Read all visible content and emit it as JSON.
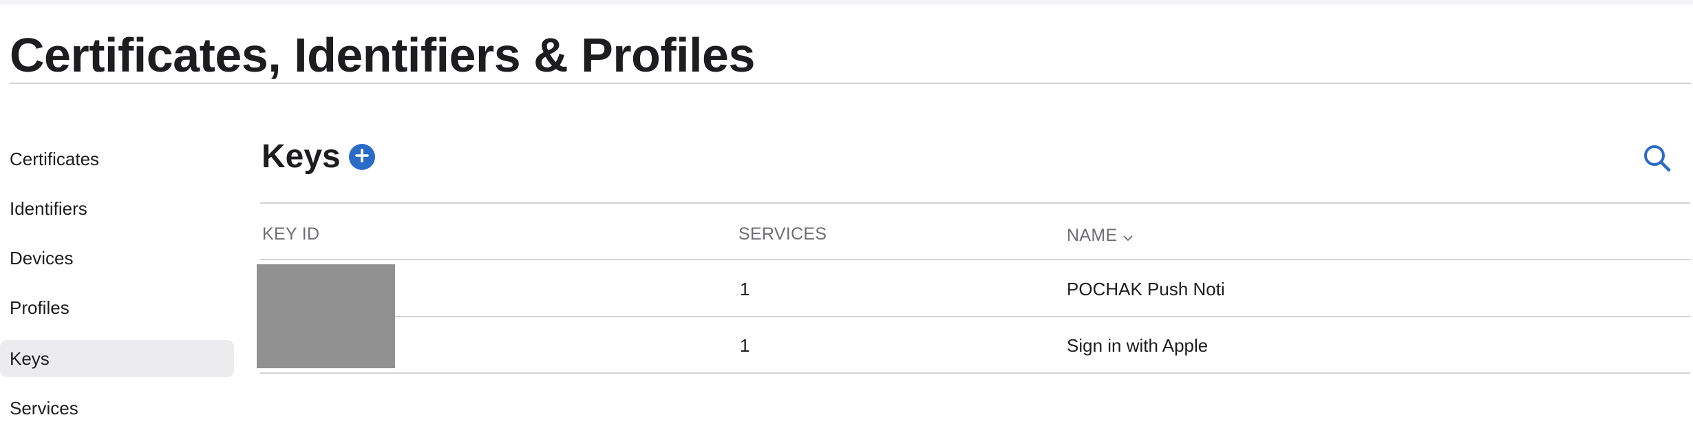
{
  "header": {
    "title": "Certificates, Identifiers & Profiles"
  },
  "sidebar": {
    "items": [
      {
        "label": "Certificates",
        "active": false
      },
      {
        "label": "Identifiers",
        "active": false
      },
      {
        "label": "Devices",
        "active": false
      },
      {
        "label": "Profiles",
        "active": false
      },
      {
        "label": "Keys",
        "active": true
      },
      {
        "label": "Services",
        "active": false
      }
    ]
  },
  "main": {
    "section_title": "Keys",
    "add_icon": "plus-circle-icon",
    "search_icon": "search-icon",
    "table": {
      "columns": [
        "KEY ID",
        "SERVICES",
        "NAME"
      ],
      "sort_column": "NAME",
      "sort_icon": "chevron-down-icon",
      "rows": [
        {
          "key_id": "",
          "services": "1",
          "name": "POCHAK Push Noti"
        },
        {
          "key_id": "",
          "services": "1",
          "name": "Sign in with Apple"
        }
      ]
    }
  },
  "colors": {
    "accent": "#2b6bc8",
    "text": "#1d1d1f",
    "muted": "#6e6e73",
    "divider": "#d2d2d7",
    "active_bg": "#ececee",
    "redaction": "#919191"
  }
}
